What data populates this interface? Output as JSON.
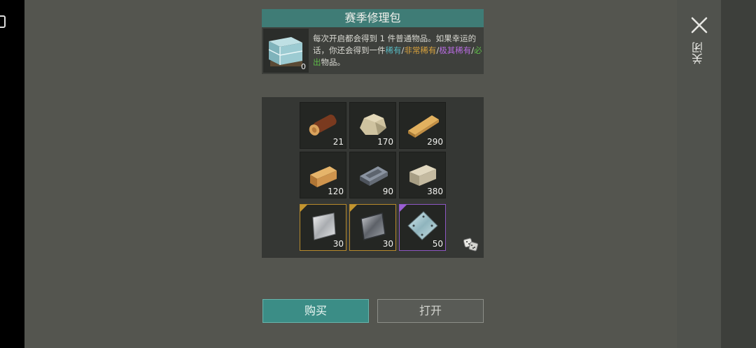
{
  "dialog": {
    "title": "赛季修理包",
    "pack_count": "0",
    "description_parts": {
      "p1": "每次开启都会得到 1 件普通物品。如果幸运的话，你还会得到一件",
      "rare": "稀有",
      "sep1": "/",
      "very_rare": "非常稀有",
      "sep2": "/",
      "epic": "极其稀有",
      "sep3": "/",
      "must": "必出",
      "p2": "物品。"
    }
  },
  "close": {
    "label": "关闭",
    "icon": "close-icon"
  },
  "items": [
    {
      "name": "log",
      "qty": "21"
    },
    {
      "name": "stone",
      "qty": "170"
    },
    {
      "name": "plank",
      "qty": "290"
    },
    {
      "name": "wood-beam",
      "qty": "120"
    },
    {
      "name": "iron-ingot",
      "qty": "90"
    },
    {
      "name": "stone-block",
      "qty": "380"
    },
    {
      "name": "steel-plate",
      "qty": "30",
      "rarity": "very_rare"
    },
    {
      "name": "iron-plate",
      "qty": "30",
      "rarity": "very_rare"
    },
    {
      "name": "glass-plate",
      "qty": "50",
      "rarity": "epic"
    }
  ],
  "buttons": {
    "buy": "购买",
    "open": "打开"
  },
  "colors": {
    "rare": "#57b9c2",
    "very_rare": "#d7a13d",
    "epic": "#b76be0",
    "must": "#5fba49",
    "accent": "#3b8d86"
  }
}
